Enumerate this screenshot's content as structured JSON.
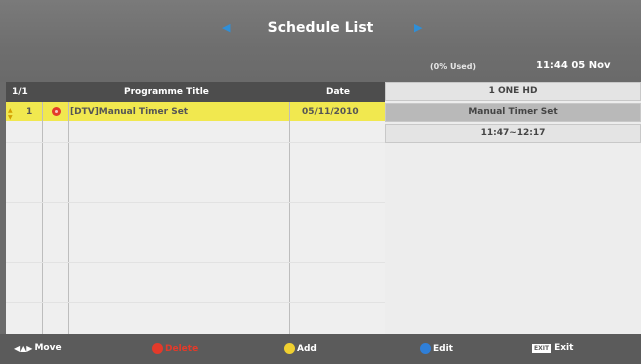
{
  "header": {
    "title": "Schedule List",
    "usage": "(0% Used)",
    "clock": "11:44 05 Nov"
  },
  "table": {
    "page": "1/1",
    "col_title": "Programme Title",
    "col_date": "Date",
    "rows": [
      {
        "num": "1",
        "title": "[DTV]Manual Timer Set",
        "date": "05/11/2010"
      }
    ]
  },
  "detail": {
    "channel": "1 ONE HD",
    "programme": "Manual Timer Set",
    "time": "11:47~12:17"
  },
  "footer": {
    "move": "Move",
    "delete": "Delete",
    "add": "Add",
    "edit": "Edit",
    "exit": "Exit",
    "exit_key": "EXIT"
  },
  "colors": {
    "selected_row": "#f1e84f",
    "red": "#e33a2a",
    "yellow": "#f0d030",
    "blue": "#2f7fd8"
  }
}
